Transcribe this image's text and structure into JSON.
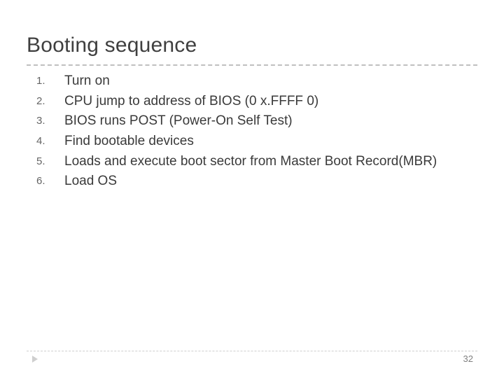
{
  "title": "Booting sequence",
  "items": [
    {
      "num": "1.",
      "text": "Turn on"
    },
    {
      "num": "2.",
      "text": "CPU jump to address of BIOS (0 x.FFFF 0)"
    },
    {
      "num": "3.",
      "text": "BIOS runs POST (Power-On Self Test)"
    },
    {
      "num": "4.",
      "text": "Find bootable devices"
    },
    {
      "num": "5.",
      "text": "Loads and execute boot sector from Master Boot Record(MBR)"
    },
    {
      "num": "6.",
      "text": "Load OS"
    }
  ],
  "page_number": "32"
}
